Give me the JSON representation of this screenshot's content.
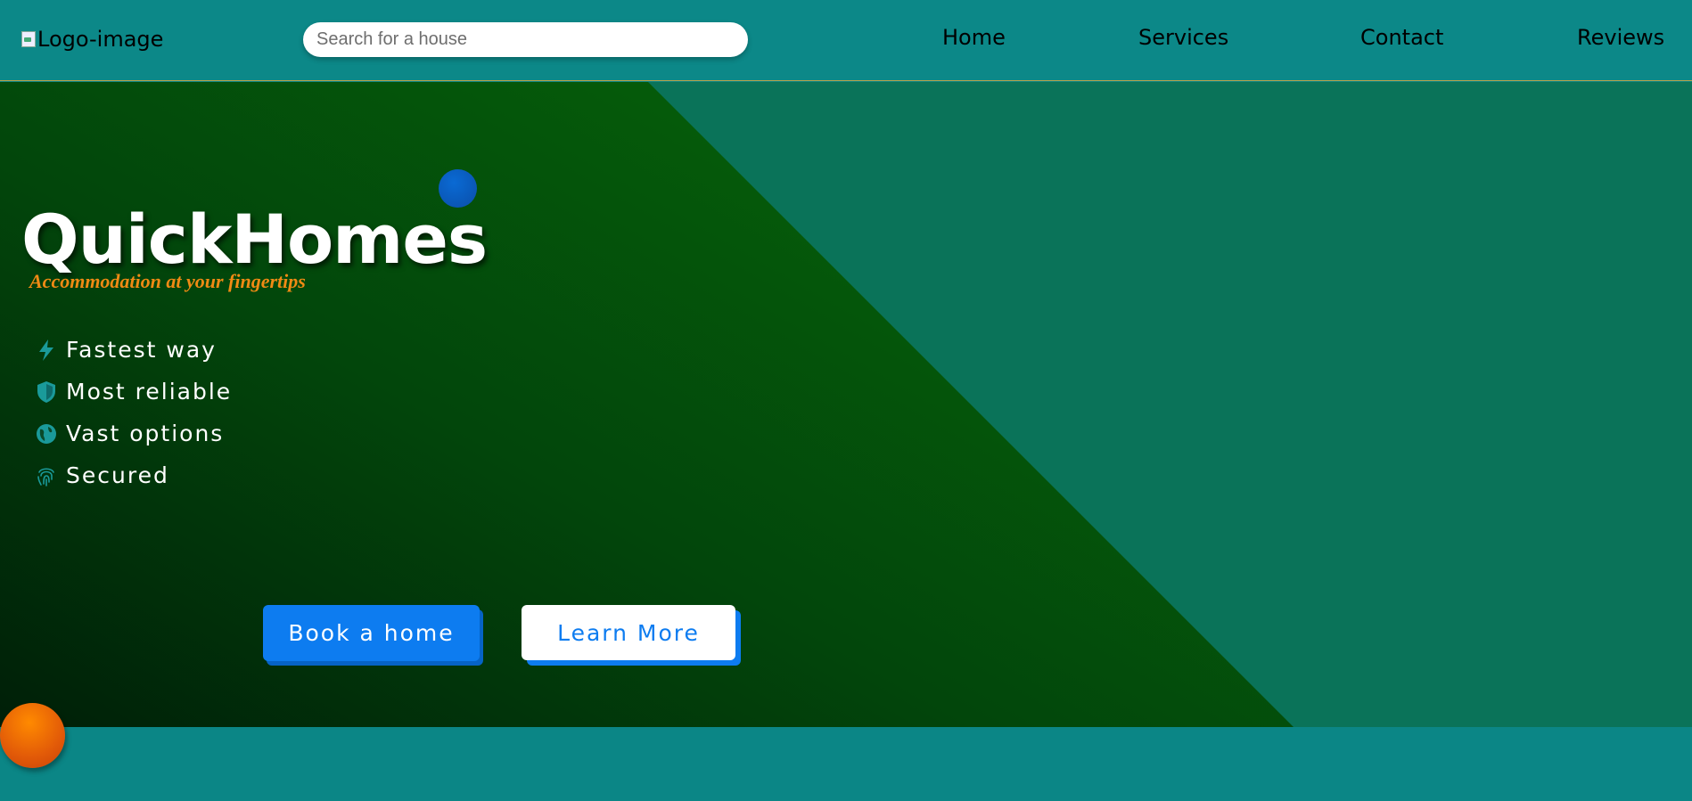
{
  "header": {
    "logo_alt": "Logo-image",
    "search": {
      "placeholder": "Search for a house",
      "value": ""
    },
    "nav": [
      {
        "label": "Home"
      },
      {
        "label": "Services"
      },
      {
        "label": "Contact"
      },
      {
        "label": "Reviews"
      }
    ]
  },
  "hero": {
    "title": "QuickHomes",
    "tagline": "Accommodation at your fingertips",
    "features": [
      {
        "label": "Fastest way",
        "icon": "lightning-icon"
      },
      {
        "label": "Most reliable",
        "icon": "shield-icon"
      },
      {
        "label": "Vast options",
        "icon": "globe-icon"
      },
      {
        "label": "Secured",
        "icon": "fingerprint-icon"
      }
    ],
    "buttons": {
      "book": "Book a home",
      "learn": "Learn More"
    }
  },
  "colors": {
    "nav_bg": "#0c8888",
    "hero_teal": "#0a7359",
    "hero_green": "#06600a",
    "accent_blue": "#0d7cf0",
    "tagline_orange": "#f08a14",
    "icon_teal": "#1a8a8a",
    "ball_orange": "#e25a08"
  }
}
